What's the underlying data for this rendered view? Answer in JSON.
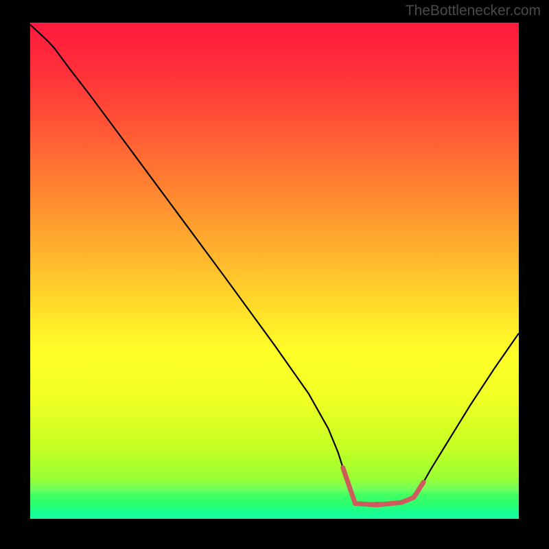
{
  "watermark": "TheBottlenecker.com",
  "chart_data": {
    "type": "line",
    "title": "",
    "xlabel": "",
    "ylabel": "",
    "xlim": [
      0,
      100
    ],
    "ylim": [
      0,
      100
    ],
    "background_gradient": {
      "stops": [
        {
          "pos": 0.0,
          "color": "#ff1a3e"
        },
        {
          "pos": 0.095,
          "color": "#ff2f3a"
        },
        {
          "pos": 0.19,
          "color": "#ff4f37"
        },
        {
          "pos": 0.285,
          "color": "#ff7133"
        },
        {
          "pos": 0.38,
          "color": "#ff9430"
        },
        {
          "pos": 0.476,
          "color": "#ffb82d"
        },
        {
          "pos": 0.571,
          "color": "#ffdc2a"
        },
        {
          "pos": 0.666,
          "color": "#ffff28"
        },
        {
          "pos": 0.761,
          "color": "#efff25"
        },
        {
          "pos": 0.856,
          "color": "#c6ff23"
        },
        {
          "pos": 0.92,
          "color": "#98ff36"
        },
        {
          "pos": 0.94,
          "color": "#72ff5c"
        },
        {
          "pos": 0.952,
          "color": "#40ff62"
        },
        {
          "pos": 0.972,
          "color": "#2bff70"
        },
        {
          "pos": 0.985,
          "color": "#1bff8e"
        },
        {
          "pos": 1.0,
          "color": "#17ffa2"
        }
      ]
    },
    "series": [
      {
        "name": "curve",
        "stroke": "#000000",
        "stroke_width": 2.2,
        "x": [
          0.0,
          3.5,
          5.0,
          8.0,
          12.0,
          20.0,
          30.0,
          40.0,
          50.0,
          57.0,
          61.0,
          63.0,
          64.0,
          66.5,
          76.0,
          78.0,
          80.5,
          82.0,
          85.0,
          90.0,
          95.0,
          100.0
        ],
        "y": [
          99.6,
          96.4,
          94.8,
          90.8,
          85.7,
          75.1,
          61.8,
          48.5,
          35.0,
          25.2,
          18.2,
          13.4,
          10.3,
          3.1,
          3.3,
          4.0,
          7.4,
          10.0,
          14.8,
          22.8,
          30.3,
          37.4
        ]
      },
      {
        "name": "highlight",
        "stroke": "#cd5c5c",
        "stroke_width": 7,
        "linecap": "round",
        "x": [
          64.0,
          66.5,
          71.0,
          76.0,
          78.5,
          80.5
        ],
        "y": [
          10.3,
          3.1,
          2.8,
          3.3,
          4.3,
          7.4
        ]
      }
    ]
  }
}
